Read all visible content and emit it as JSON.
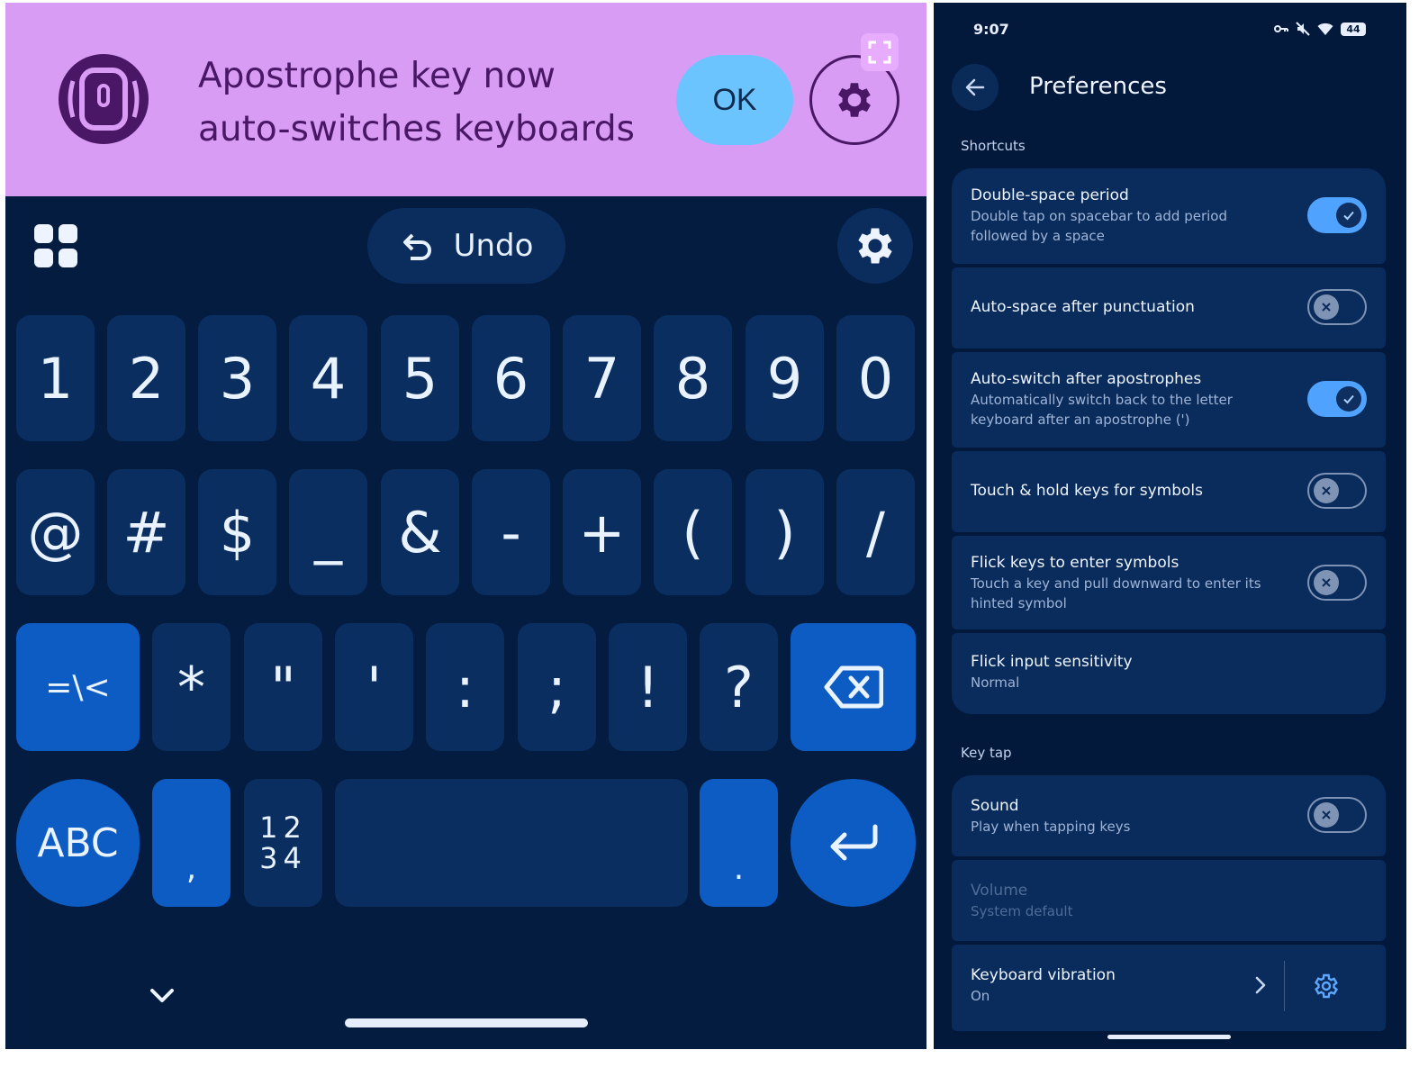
{
  "banner": {
    "message_line1": "Apostrophe key now",
    "message_line2": "auto-switches keyboards",
    "ok_label": "OK",
    "bg_color": "#d99cf4",
    "logo_icon": "gboard-logo-icon",
    "settings_icon": "gear-icon",
    "expand_icon": "fullscreen-icon"
  },
  "toolbar": {
    "menu_icon": "apps-grid-icon",
    "undo_label": "Undo",
    "undo_icon": "undo-icon",
    "settings_icon": "gear-icon"
  },
  "keyboard": {
    "row1": [
      "1",
      "2",
      "3",
      "4",
      "5",
      "6",
      "7",
      "8",
      "9",
      "0"
    ],
    "row2": [
      "@",
      "#",
      "$",
      "_",
      "&",
      "-",
      "+",
      "(",
      ")",
      "/"
    ],
    "row3": [
      "=\\<",
      "*",
      "\"",
      "'",
      ":",
      ";",
      "!",
      "?"
    ],
    "row3_backspace_icon": "backspace-icon",
    "row4": {
      "abc": "ABC",
      "comma": ",",
      "numpad_top": "12",
      "numpad_bottom": "34",
      "period": ".",
      "enter_icon": "enter-icon"
    },
    "collapse_icon": "chevron-down-icon",
    "accent_color": "#0c5cc4"
  },
  "prefs": {
    "status_time": "9:07",
    "battery": "44",
    "title": "Preferences",
    "back_icon": "arrow-back-icon",
    "sections": [
      {
        "label": "Shortcuts",
        "rows": [
          {
            "title": "Double-space period",
            "sub1": "Double tap on spacebar to add period",
            "sub2": "followed by a space",
            "toggle": true
          },
          {
            "title": "Auto-space after punctuation",
            "toggle": false
          },
          {
            "title": "Auto-switch after apostrophes",
            "sub1": "Automatically switch back to the letter",
            "sub2": "keyboard after an apostrophe (')",
            "toggle": true
          },
          {
            "title": "Touch & hold keys for symbols",
            "toggle": false
          },
          {
            "title": "Flick keys to enter symbols",
            "sub1": "Touch a key and pull downward to enter its",
            "sub2": "hinted symbol",
            "toggle": false
          },
          {
            "title": "Flick input sensitivity",
            "sub1": "Normal"
          }
        ]
      },
      {
        "label": "Key tap",
        "rows": [
          {
            "title": "Sound",
            "sub1": "Play when tapping keys",
            "toggle": false
          },
          {
            "title": "Volume",
            "sub1": "System default",
            "disabled": true
          },
          {
            "title": "Keyboard vibration",
            "sub1": "On"
          }
        ]
      }
    ]
  }
}
